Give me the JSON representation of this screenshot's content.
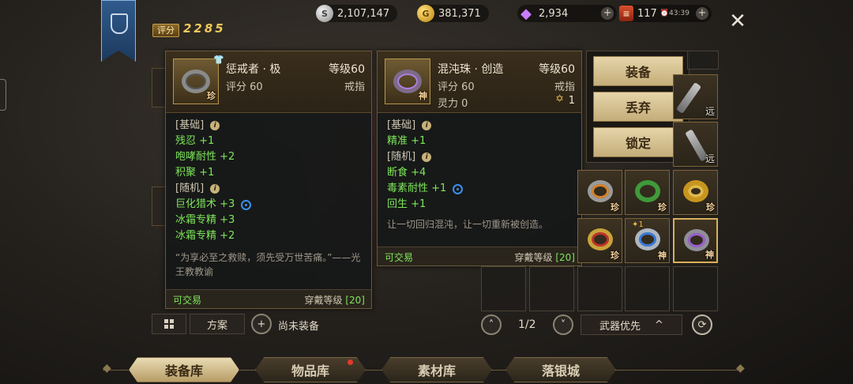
{
  "top": {
    "currencies": [
      {
        "icon": "silver-coin-icon",
        "glyph": "S",
        "value": "2,107,147"
      },
      {
        "icon": "gold-coin-icon",
        "glyph": "G",
        "value": "381,371"
      },
      {
        "icon": "diamond-icon",
        "glyph": "◆",
        "value": "2,934"
      },
      {
        "icon": "scroll-ticket-icon",
        "glyph": "≡",
        "value": "117",
        "timer": "⏰43:39"
      }
    ],
    "plus": "+",
    "close": "✕"
  },
  "score": {
    "label": "评分",
    "value": "2285"
  },
  "tooltip_left": {
    "name": "惩戒者 · 极",
    "level": "等级60",
    "score": "评分 60",
    "slot": "戒指",
    "tag": "珍",
    "base_header": "[基础]",
    "base_stats": [
      "残忍 +1",
      "咆哮耐性 +2",
      "积聚 +1"
    ],
    "random_header": "[随机]",
    "random_stats": [
      "巨化猎术 +3",
      "冰霜专精 +3",
      "冰霜专精 +2"
    ],
    "flavor": "“为享必至之救赎，须先受万世苦痛。”——光王教教谕",
    "trade": "可交易",
    "wear_label": "穿戴等级",
    "wear_level": "[20]"
  },
  "tooltip_right": {
    "name": "混沌珠 · 创造",
    "level": "等级60",
    "score": "评分 60",
    "slot": "戒指",
    "spirit": "灵力 0",
    "star_count": "1",
    "tag": "神",
    "base_header": "[基础]",
    "base_stats": [
      "精准 +1"
    ],
    "random_header": "[随机]",
    "random_stats": [
      "断食 +4",
      "毒素耐性 +1",
      "回生 +1"
    ],
    "flavor": "让一切回归混沌，让一切重新被创造。",
    "trade": "可交易",
    "wear_label": "穿戴等级",
    "wear_level": "[20]"
  },
  "actions": {
    "equip": "装备",
    "discard": "丢弃",
    "lock": "锁定"
  },
  "inventory": {
    "weapons": [
      {
        "tag": "远"
      },
      {
        "tag": "远"
      }
    ],
    "rings_row1": [
      {
        "tag": "珍"
      },
      {
        "tag": "珍"
      },
      {
        "tag": "珍"
      }
    ],
    "rings_row2": [
      {
        "tag": "珍"
      },
      {
        "tag": "神",
        "stone": "✦1"
      },
      {
        "tag": "神"
      }
    ]
  },
  "controls": {
    "plan": "方案",
    "unequipped": "尚未装备",
    "page": "1/2",
    "sort": "武器优先",
    "caret": "^"
  },
  "nav": [
    "装备库",
    "物品库",
    "素材库",
    "落银城"
  ]
}
